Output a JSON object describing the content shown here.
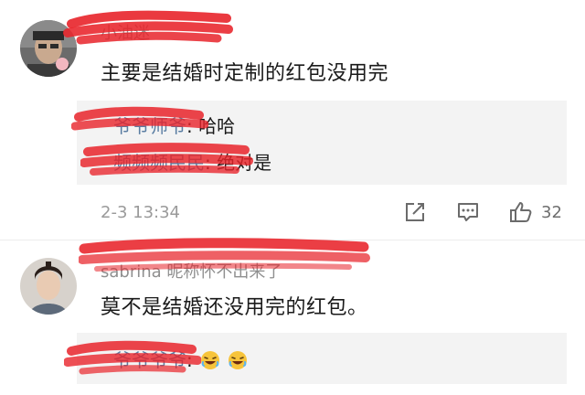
{
  "comments": [
    {
      "username": "小油迷",
      "text": "主要是结婚时定制的红包没用完",
      "replies": [
        {
          "user": "爷爷师爷",
          "text": ": 哈哈"
        },
        {
          "user": "频频频民民",
          "text": ": 绝对是"
        }
      ],
      "timestamp": "2-3 13:34",
      "likes": "32"
    },
    {
      "username": "sabrina 昵称怀不出来了",
      "text": "莫不是结婚还没用完的红包。",
      "replies": [
        {
          "user": "爷爷爷爷",
          "text": ":"
        }
      ]
    }
  ],
  "icons": {
    "share": "share-icon",
    "comment": "comment-icon",
    "like": "thumbs-up-icon",
    "laugh": "laughing-emoji-icon"
  },
  "colors": {
    "redaction": "#e8232a",
    "reply_user": "#5b7ea3",
    "reply_bg": "#f3f3f3",
    "meta": "#9a9a9a"
  }
}
